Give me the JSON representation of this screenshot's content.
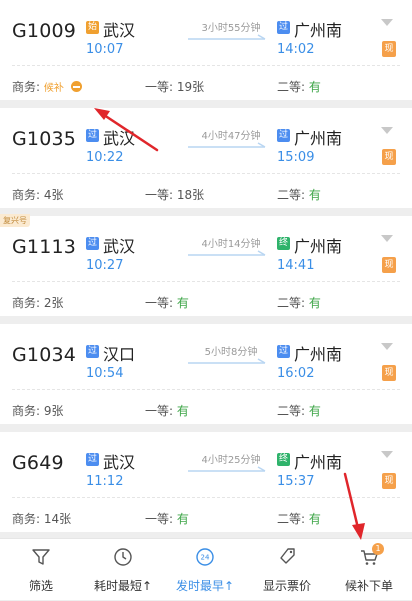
{
  "trains": [
    {
      "train_no": "G1009",
      "from_icon": "始",
      "from_icon_type": "start",
      "from_station": "武汉",
      "dep_time": "10:07",
      "duration": "3小时55分钟",
      "to_icon": "过",
      "to_icon_type": "pass",
      "to_station": "广州南",
      "arr_time": "14:02",
      "tag": "现",
      "seats": {
        "business_label": "商务:",
        "business_value": "候补",
        "first_label": "一等:",
        "first_value": "19张",
        "second_label": "二等:",
        "second_value": "有"
      }
    },
    {
      "train_no": "G1035",
      "from_icon": "过",
      "from_icon_type": "pass",
      "from_station": "武汉",
      "dep_time": "10:22",
      "duration": "4小时47分钟",
      "to_icon": "过",
      "to_icon_type": "pass",
      "to_station": "广州南",
      "arr_time": "15:09",
      "tag": "现",
      "seats": {
        "business_label": "商务:",
        "business_value": "4张",
        "first_label": "一等:",
        "first_value": "18张",
        "second_label": "二等:",
        "second_value": "有"
      }
    },
    {
      "train_no": "G1113",
      "badge": "复兴号",
      "from_icon": "过",
      "from_icon_type": "pass",
      "from_station": "武汉",
      "dep_time": "10:27",
      "duration": "4小时14分钟",
      "to_icon": "终",
      "to_icon_type": "end",
      "to_station": "广州南",
      "arr_time": "14:41",
      "tag": "现",
      "seats": {
        "business_label": "商务:",
        "business_value": "2张",
        "first_label": "一等:",
        "first_value": "有",
        "second_label": "二等:",
        "second_value": "有"
      }
    },
    {
      "train_no": "G1034",
      "from_icon": "过",
      "from_icon_type": "pass",
      "from_station": "汉口",
      "dep_time": "10:54",
      "duration": "5小时8分钟",
      "to_icon": "过",
      "to_icon_type": "pass",
      "to_station": "广州南",
      "arr_time": "16:02",
      "tag": "现",
      "seats": {
        "business_label": "商务:",
        "business_value": "9张",
        "first_label": "一等:",
        "first_value": "有",
        "second_label": "二等:",
        "second_value": "有"
      }
    },
    {
      "train_no": "G649",
      "from_icon": "过",
      "from_icon_type": "pass",
      "from_station": "武汉",
      "dep_time": "11:12",
      "duration": "4小时25分钟",
      "to_icon": "终",
      "to_icon_type": "end",
      "to_station": "广州南",
      "arr_time": "15:37",
      "tag": "现",
      "seats": {
        "business_label": "商务:",
        "business_value": "14张",
        "first_label": "一等:",
        "first_value": "有",
        "second_label": "二等:",
        "second_value": "有"
      }
    }
  ],
  "toolbar": {
    "filter": "筛选",
    "shortest": "耗时最短↑",
    "earliest": "发时最早↑",
    "earliest_icon_text": "24",
    "show_price": "显示票价",
    "waitlist_order": "候补下单",
    "waitlist_count": "1"
  },
  "colors": {
    "accent_blue": "#3a8ee6",
    "available_green": "#3da547",
    "orange": "#f0a030",
    "annotation_red": "#e0262b"
  }
}
